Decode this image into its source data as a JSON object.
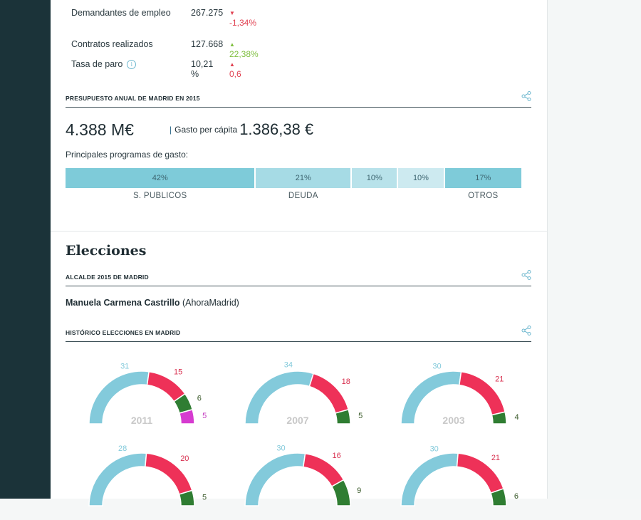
{
  "stats": [
    {
      "label": "Demandantes de empleo",
      "value": "267.275",
      "change": "-1,34%",
      "direction": "down",
      "info": false
    },
    {
      "label": "Contratos realizados",
      "value": "127.668",
      "change": "22,38%",
      "direction": "up",
      "info": false
    },
    {
      "label": "Tasa de paro",
      "value": "10,21 %",
      "change": "0,6",
      "direction": "up-bad",
      "info": true
    }
  ],
  "budget": {
    "section_title": "PRESUPUESTO ANUAL DE MADRID EN 2015",
    "total": "4.388 M€",
    "per_capita_label": "Gasto per cápita",
    "per_capita_value": "1.386,38 €",
    "programs_label": "Principales programas de gasto:",
    "segments": [
      {
        "pct": 42,
        "text": "42%",
        "label": "S. PUBLICOS",
        "color": "#7ecbd9"
      },
      {
        "pct": 21,
        "text": "21%",
        "label": "DEUDA",
        "color": "#a6dbe5"
      },
      {
        "pct": 10,
        "text": "10%",
        "label": "",
        "color": "#b8e2ea"
      },
      {
        "pct": 10,
        "text": "10%",
        "label": "",
        "color": "#cdeaf0"
      },
      {
        "pct": 17,
        "text": "17%",
        "label": "OTROS",
        "color": "#7ecbd9"
      }
    ]
  },
  "elections": {
    "heading": "Elecciones",
    "mayor_section_title": "ALCALDE 2015 DE MADRID",
    "mayor_name": "Manuela Carmena Castrillo",
    "mayor_party": "(AhoraMadrid)",
    "history_section_title": "HISTÓRICO ELECCIONES EN MADRID",
    "colors": {
      "blue": "#83cadb",
      "red": "#ee3158",
      "green": "#2f7d32",
      "magenta": "#d63bd0"
    }
  },
  "chart_data": [
    {
      "type": "pie",
      "subtype": "half-donut",
      "year": "2011",
      "series": [
        {
          "color": "blue",
          "value": 31
        },
        {
          "color": "red",
          "value": 15
        },
        {
          "color": "green",
          "value": 6
        },
        {
          "color": "magenta",
          "value": 5
        }
      ]
    },
    {
      "type": "pie",
      "subtype": "half-donut",
      "year": "2007",
      "series": [
        {
          "color": "blue",
          "value": 34
        },
        {
          "color": "red",
          "value": 18
        },
        {
          "color": "green",
          "value": 5
        }
      ]
    },
    {
      "type": "pie",
      "subtype": "half-donut",
      "year": "2003",
      "series": [
        {
          "color": "blue",
          "value": 30
        },
        {
          "color": "red",
          "value": 21
        },
        {
          "color": "green",
          "value": 4
        }
      ]
    },
    {
      "type": "pie",
      "subtype": "half-donut",
      "year": "",
      "series": [
        {
          "color": "blue",
          "value": 28
        },
        {
          "color": "red",
          "value": 20
        },
        {
          "color": "green",
          "value": 5
        }
      ]
    },
    {
      "type": "pie",
      "subtype": "half-donut",
      "year": "",
      "series": [
        {
          "color": "blue",
          "value": 30
        },
        {
          "color": "red",
          "value": 16
        },
        {
          "color": "green",
          "value": 9
        }
      ]
    },
    {
      "type": "pie",
      "subtype": "half-donut",
      "year": "",
      "series": [
        {
          "color": "blue",
          "value": 30
        },
        {
          "color": "red",
          "value": 21
        },
        {
          "color": "green",
          "value": 6
        }
      ]
    }
  ]
}
